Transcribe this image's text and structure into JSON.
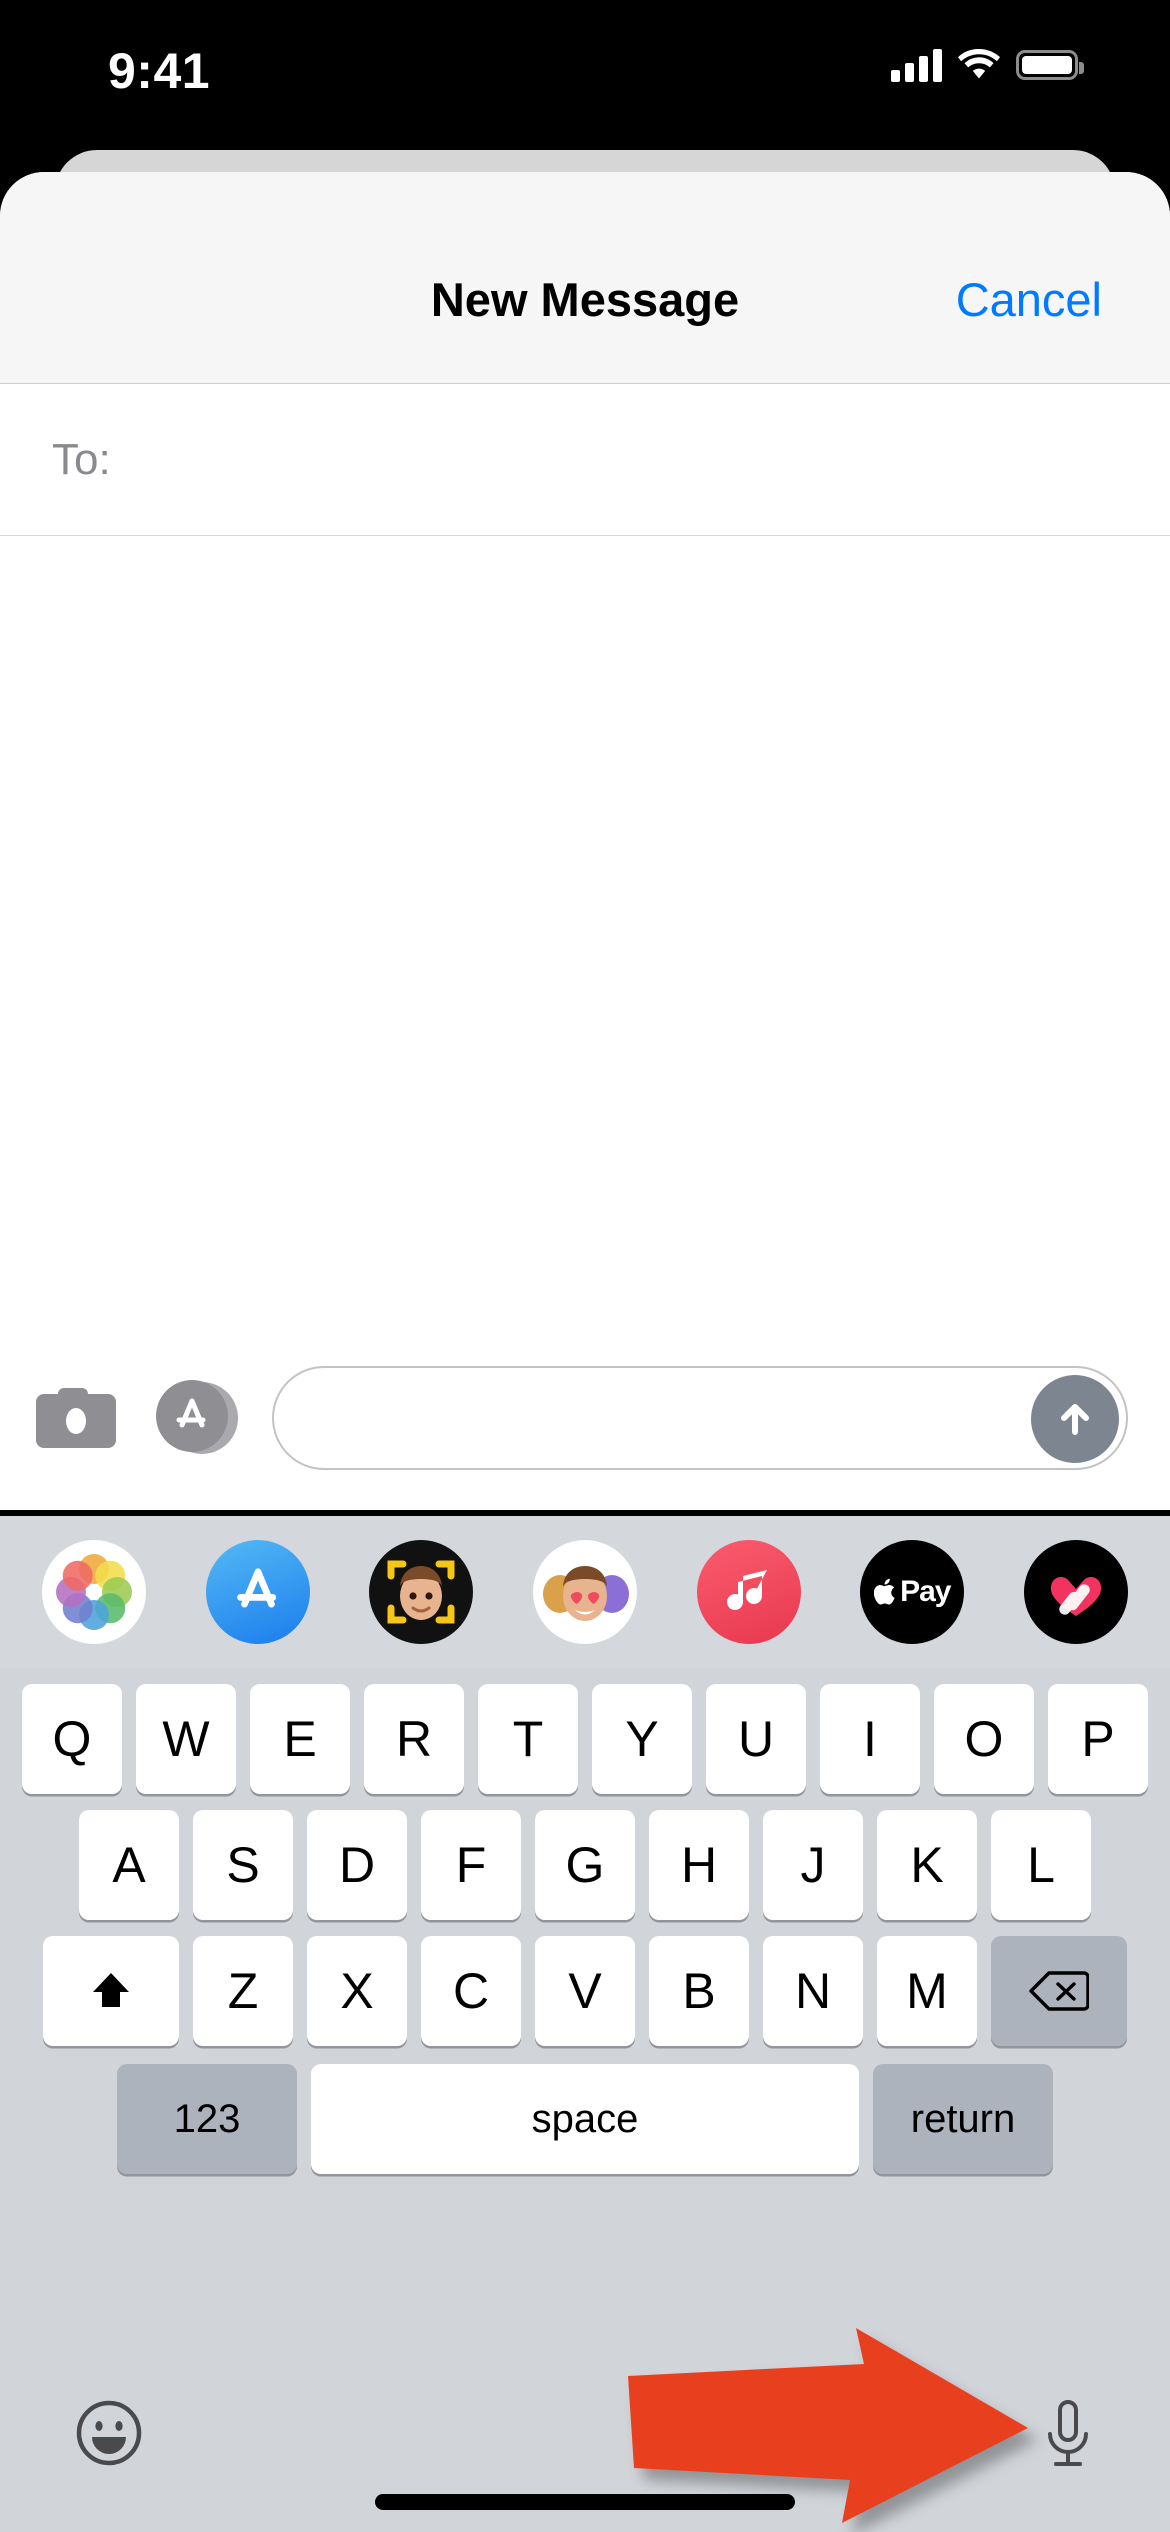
{
  "status_bar": {
    "time": "9:41",
    "cellular_icon": "cellular-signal-icon",
    "cellular_bars": 4,
    "wifi_icon": "wifi-icon",
    "battery_icon": "battery-full-icon"
  },
  "header": {
    "title": "New Message",
    "cancel_label": "Cancel",
    "cancel_color": "#007aff"
  },
  "recipient": {
    "label": "To:",
    "value": "",
    "placeholder": ""
  },
  "toolbar": {
    "camera_icon": "camera-icon",
    "apps_icon": "app-store-icon",
    "input_value": "",
    "input_placeholder": "",
    "send_icon": "send-arrow-up-icon"
  },
  "app_drawer": {
    "apps": [
      {
        "name": "Photos",
        "icon": "photos-icon"
      },
      {
        "name": "App Store",
        "icon": "app-store-icon"
      },
      {
        "name": "Memoji Camera",
        "icon": "memoji-camera-icon"
      },
      {
        "name": "Memoji Stickers",
        "icon": "memoji-stickers-icon"
      },
      {
        "name": "Apple Music",
        "icon": "apple-music-icon"
      },
      {
        "name": "Apple Pay",
        "icon": "apple-pay-icon",
        "label": "Pay"
      },
      {
        "name": "Digital Touch",
        "icon": "digital-touch-heart-icon"
      }
    ]
  },
  "keyboard": {
    "row1": [
      "Q",
      "W",
      "E",
      "R",
      "T",
      "Y",
      "U",
      "I",
      "O",
      "P"
    ],
    "row2": [
      "A",
      "S",
      "D",
      "F",
      "G",
      "H",
      "J",
      "K",
      "L"
    ],
    "row3": [
      "Z",
      "X",
      "C",
      "V",
      "B",
      "N",
      "M"
    ],
    "shift_icon": "shift-arrow-up-icon",
    "backspace_icon": "backspace-delete-icon",
    "numbers_label": "123",
    "space_label": "space",
    "return_label": "return",
    "emoji_icon": "emoji-smiley-icon",
    "dictation_icon": "microphone-icon"
  },
  "annotation": {
    "arrow_icon": "red-pointer-arrow-icon",
    "arrow_color": "#e8401f",
    "points_at": "microphone-icon"
  },
  "home_indicator": "home-indicator-bar"
}
